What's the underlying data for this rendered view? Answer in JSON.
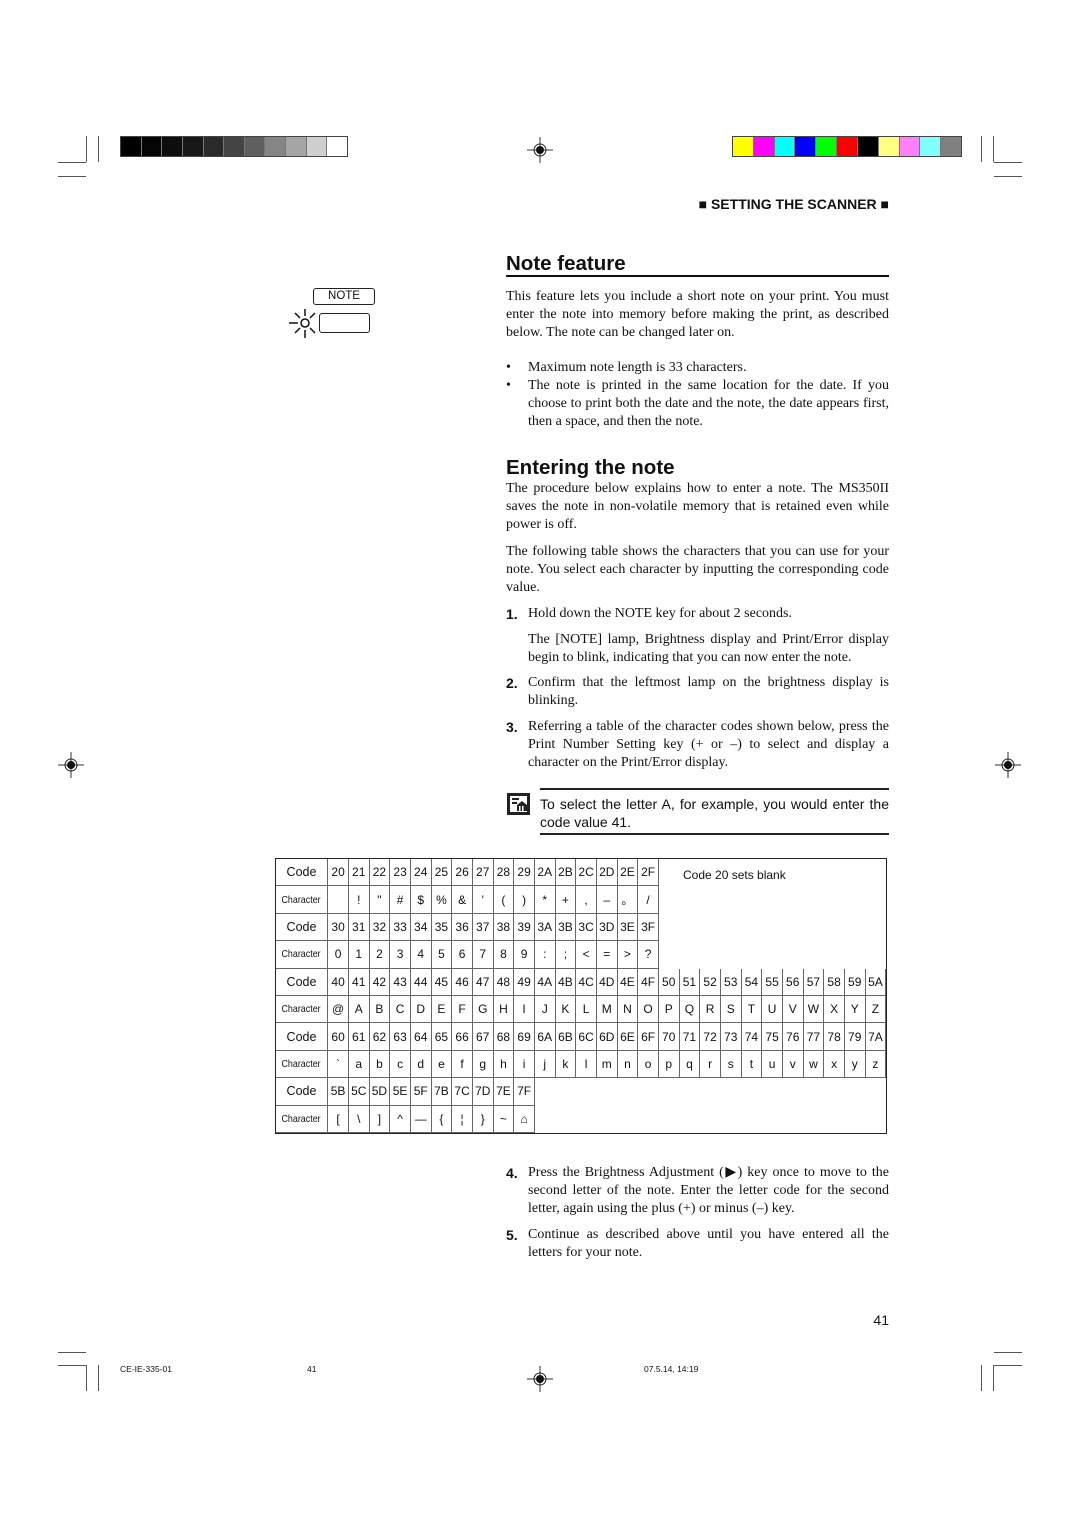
{
  "header": {
    "section": "■ SETTING THE SCANNER ■"
  },
  "colors": {
    "gray_bar": [
      "#000000",
      "#050505",
      "#0d0d0d",
      "#181818",
      "#2a2a2a",
      "#444444",
      "#5f5f5f",
      "#858585",
      "#a5a5a5",
      "#cfcfcf",
      "#ffffff"
    ],
    "color_bar": [
      "#ffff00",
      "#ff00ff",
      "#00ffff",
      "#0000ff",
      "#00ff00",
      "#ff0000",
      "#000000",
      "#ffff80",
      "#ff80ff",
      "#80ffff",
      "#808080"
    ]
  },
  "note_panel": {
    "key_label": "NOTE"
  },
  "note_feature": {
    "title": "Note feature",
    "intro": "This feature lets you include a short note on your print. You must enter the note into memory before making the print, as described below. The note can be changed later on.",
    "bullets": [
      "Maximum note length is 33 characters.",
      "The note is printed in the same location for the date. If you choose to print both the date and the note, the date appears first, then a space, and then the note."
    ]
  },
  "entering": {
    "title": "Entering the note",
    "p1": "The procedure below explains how to enter a note. The MS350II saves the note in non-volatile memory that is retained even while power is off.",
    "p2": "The following table shows the characters that you can use for your note. You select each character by inputting the corresponding code value.",
    "steps": [
      {
        "num": "1.",
        "text": "Hold down the NOTE key for about 2 seconds.",
        "sub": "The [NOTE] lamp, Brightness display and Print/Error display begin to blink, indicating that you can now enter the note."
      },
      {
        "num": "2.",
        "text": "Confirm that the leftmost lamp on the brightness display is blinking."
      },
      {
        "num": "3.",
        "text": "Referring a table of the character codes shown below, press the Print Number Setting key (+ or –) to select and display a character on the Print/Error display."
      },
      {
        "num": "4.",
        "text": "Press the Brightness Adjustment (▶) key once to move to the second letter of the note. Enter the letter code for the second letter, again using the plus (+) or minus (–) key."
      },
      {
        "num": "5.",
        "text": "Continue as described above until you have entered all the letters for your note."
      }
    ],
    "tip": "To select the letter A, for example, you would enter the code value 41."
  },
  "table": {
    "code_label": "Code",
    "char_label": "Character",
    "note": "Code 20 sets blank",
    "groups": [
      {
        "codes": [
          "20",
          "21",
          "22",
          "23",
          "24",
          "25",
          "26",
          "27",
          "28",
          "29",
          "2A",
          "2B",
          "2C",
          "2D",
          "2E",
          "2F"
        ],
        "chars": [
          "",
          " !",
          "\"",
          "#",
          "$",
          "%",
          "&",
          "'",
          "(",
          ")",
          "*",
          "+",
          ",",
          "–",
          "。",
          "/"
        ]
      },
      {
        "codes": [
          "30",
          "31",
          "32",
          "33",
          "34",
          "35",
          "36",
          "37",
          "38",
          "39",
          "3A",
          "3B",
          "3C",
          "3D",
          "3E",
          "3F"
        ],
        "chars": [
          "0",
          "1",
          "2",
          "3",
          "4",
          "5",
          "6",
          "7",
          "8",
          "9",
          ":",
          ";",
          "<",
          "=",
          ">",
          "?"
        ]
      },
      {
        "codes": [
          "40",
          "41",
          "42",
          "43",
          "44",
          "45",
          "46",
          "47",
          "48",
          "49",
          "4A",
          "4B",
          "4C",
          "4D",
          "4E",
          "4F",
          "50",
          "51",
          "52",
          "53",
          "54",
          "55",
          "56",
          "57",
          "58",
          "59",
          "5A"
        ],
        "chars": [
          "@",
          "A",
          "B",
          "C",
          "D",
          "E",
          "F",
          "G",
          "H",
          "I",
          "J",
          "K",
          "L",
          "M",
          "N",
          "O",
          "P",
          "Q",
          "R",
          "S",
          "T",
          "U",
          "V",
          "W",
          "X",
          "Y",
          "Z"
        ]
      },
      {
        "codes": [
          "60",
          "61",
          "62",
          "63",
          "64",
          "65",
          "66",
          "67",
          "68",
          "69",
          "6A",
          "6B",
          "6C",
          "6D",
          "6E",
          "6F",
          "70",
          "71",
          "72",
          "73",
          "74",
          "75",
          "76",
          "77",
          "78",
          "79",
          "7A"
        ],
        "chars": [
          "`",
          "a",
          "b",
          "c",
          "d",
          "e",
          "f",
          "g",
          "h",
          "i",
          "j",
          "k",
          "l",
          "m",
          "n",
          "o",
          "p",
          "q",
          "r",
          "s",
          "t",
          "u",
          "v",
          "w",
          "x",
          "y",
          "z"
        ]
      },
      {
        "codes": [
          "5B",
          "5C",
          "5D",
          "5E",
          "5F",
          "7B",
          "7C",
          "7D",
          "7E",
          "7F"
        ],
        "chars": [
          "[",
          "\\",
          "]",
          "^",
          "—",
          "{",
          "¦",
          "}",
          "~",
          "⌂"
        ]
      }
    ]
  },
  "page_number": "41",
  "footer": {
    "doc_code": "CE-IE-335-01",
    "page": "41",
    "date": "07.5.14, 14:19"
  }
}
